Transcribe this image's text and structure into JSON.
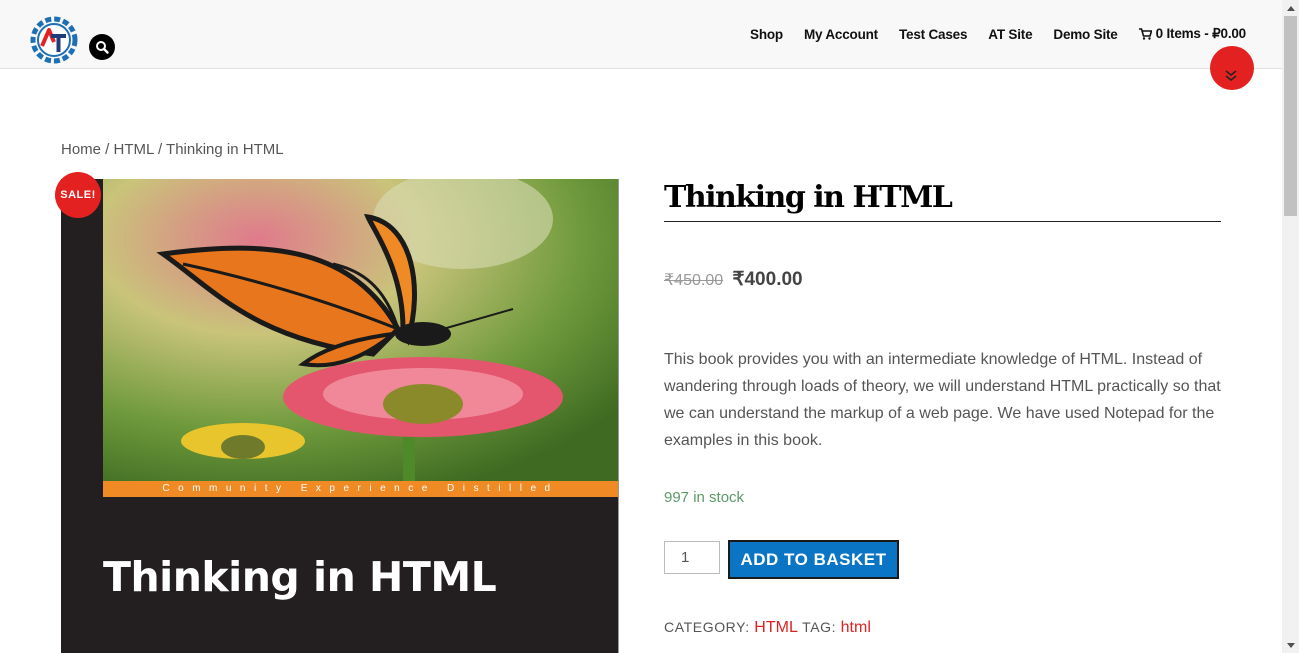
{
  "header": {
    "nav": [
      "Shop",
      "My Account",
      "Test Cases",
      "AT Site",
      "Demo Site"
    ],
    "cart_label": "0 Items - ₽0.00"
  },
  "breadcrumb": {
    "home": "Home",
    "sep": " / ",
    "category": "HTML",
    "current": "Thinking in HTML"
  },
  "product": {
    "sale_badge": "SALE!",
    "title": "Thinking in HTML",
    "old_price": "₹450.00",
    "new_price": "₹400.00",
    "description": "This book provides you with an intermediate knowledge of HTML. Instead of wandering through loads of theory, we will understand HTML practically so that we can understand the markup of a web page. We have used Notepad for the examples in this book.",
    "stock": "997 in stock",
    "quantity": "1",
    "add_button": "ADD TO BASKET",
    "category_label": "CATEGORY:",
    "category": "HTML",
    "tag_label": "TAG:",
    "tag": "html"
  },
  "cover": {
    "strip_text": "Community Experience Distilled",
    "title": "Thinking in HTML"
  },
  "colors": {
    "accent_red": "#e42121",
    "button_blue": "#0b75c5",
    "stock_green": "#5b9a68"
  }
}
